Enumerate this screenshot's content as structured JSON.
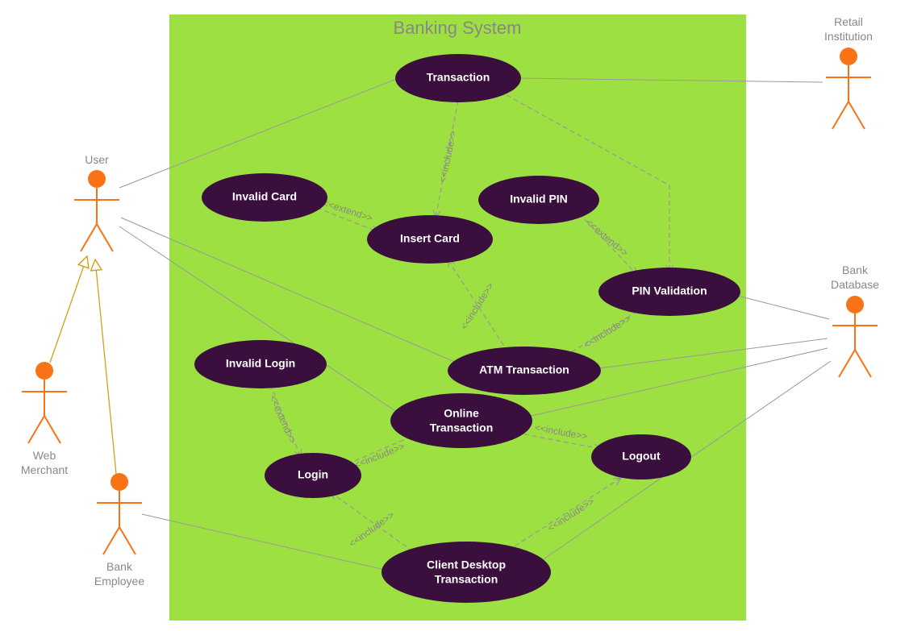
{
  "system": {
    "title": "Banking System"
  },
  "actors": {
    "user": {
      "label": "User"
    },
    "webMerchant": {
      "label": "Web",
      "label2": "Merchant"
    },
    "bankEmployee": {
      "label": "Bank",
      "label2": "Employee"
    },
    "retail": {
      "label": "Retail",
      "label2": "Institution"
    },
    "bankDb": {
      "label": "Bank",
      "label2": "Database"
    }
  },
  "usecases": {
    "transaction": {
      "label": "Transaction"
    },
    "invalidCard": {
      "label": "Invalid Card"
    },
    "insertCard": {
      "label": "Insert Card"
    },
    "invalidPin": {
      "label": "Invalid PIN"
    },
    "pinValidation": {
      "label": "PIN Validation"
    },
    "invalidLogin": {
      "label": "Invalid Login"
    },
    "atmTransaction": {
      "label": "ATM Transaction"
    },
    "onlineTransaction": {
      "label": "Online",
      "label2": "Transaction"
    },
    "logout": {
      "label": "Logout"
    },
    "login": {
      "label": "Login"
    },
    "clientDesktop": {
      "label": "Client Desktop",
      "label2": "Transaction"
    }
  },
  "stereotypes": {
    "include": "<<include>>",
    "extend": "<<extend>>"
  },
  "colors": {
    "systemBg": "#9de042",
    "usecaseFill": "#3a0f3d",
    "actorStroke": "#f97316",
    "lineGray": "#999999",
    "generalization": "#d4a017"
  }
}
